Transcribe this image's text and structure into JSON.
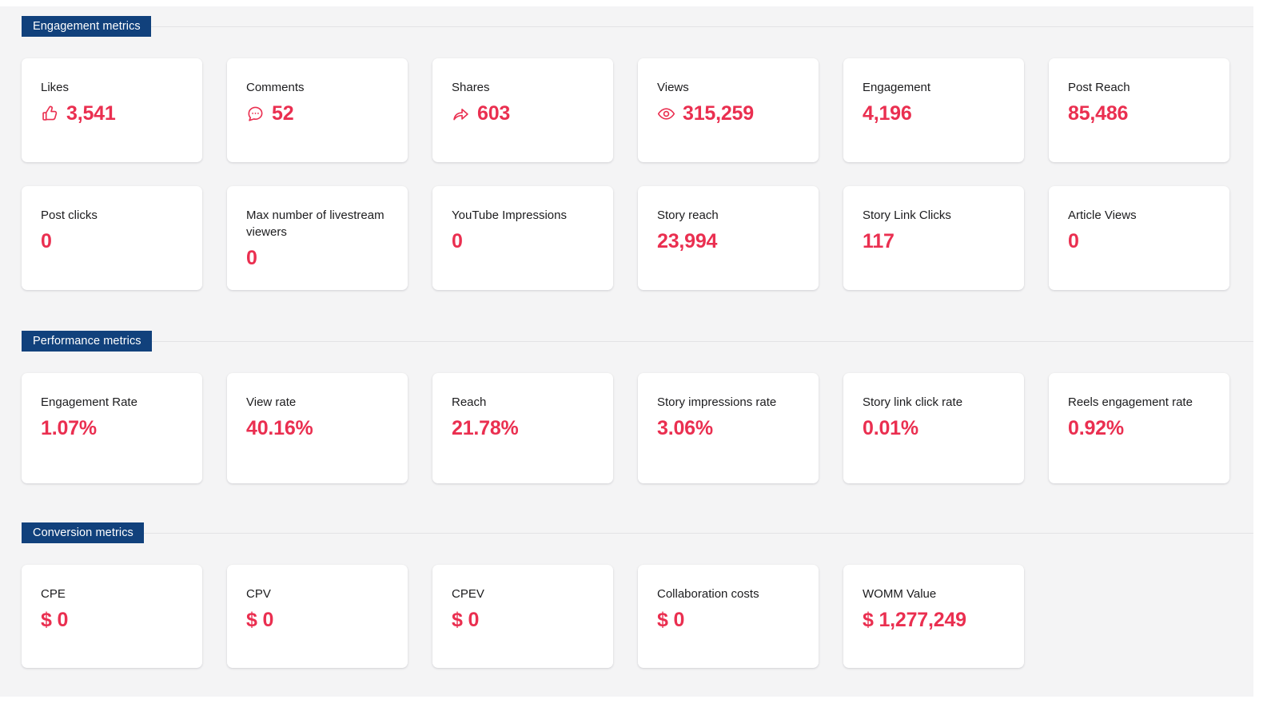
{
  "theme": {
    "accent_red": "#ea2f50",
    "badge_navy": "#11417c",
    "page_background": "#f4f4f5",
    "card_background": "#ffffff",
    "label_color": "#1c1c1e",
    "rule_color": "#e3e3e5"
  },
  "sections": [
    {
      "id": "engagement-metrics",
      "title": "Engagement metrics",
      "cards": [
        {
          "label": "Likes",
          "value": "3,541",
          "icon": "thumbs-up-icon"
        },
        {
          "label": "Comments",
          "value": "52",
          "icon": "comment-bubble-icon"
        },
        {
          "label": "Shares",
          "value": "603",
          "icon": "share-arrow-icon"
        },
        {
          "label": "Views",
          "value": "315,259",
          "icon": "eye-icon"
        },
        {
          "label": "Engagement",
          "value": "4,196",
          "icon": null
        },
        {
          "label": "Post Reach",
          "value": "85,486",
          "icon": null
        },
        {
          "label": "Post clicks",
          "value": "0",
          "icon": null
        },
        {
          "label": "Max number of livestream viewers",
          "value": "0",
          "icon": null
        },
        {
          "label": "YouTube Impressions",
          "value": "0",
          "icon": null
        },
        {
          "label": "Story reach",
          "value": "23,994",
          "icon": null
        },
        {
          "label": "Story Link Clicks",
          "value": "117",
          "icon": null
        },
        {
          "label": "Article Views",
          "value": "0",
          "icon": null
        }
      ]
    },
    {
      "id": "performance-metrics",
      "title": "Performance metrics",
      "cards": [
        {
          "label": "Engagement Rate",
          "value": "1.07%",
          "icon": null
        },
        {
          "label": "View rate",
          "value": "40.16%",
          "icon": null
        },
        {
          "label": "Reach",
          "value": "21.78%",
          "icon": null
        },
        {
          "label": "Story impressions rate",
          "value": "3.06%",
          "icon": null
        },
        {
          "label": "Story link click rate",
          "value": "0.01%",
          "icon": null
        },
        {
          "label": "Reels engagement rate",
          "value": "0.92%",
          "icon": null
        }
      ]
    },
    {
      "id": "conversion-metrics",
      "title": "Conversion metrics",
      "cards": [
        {
          "label": "CPE",
          "value": "$ 0",
          "icon": null
        },
        {
          "label": "CPV",
          "value": "$ 0",
          "icon": null
        },
        {
          "label": "CPEV",
          "value": "$ 0",
          "icon": null
        },
        {
          "label": "Collaboration costs",
          "value": "$ 0",
          "icon": null
        },
        {
          "label": "WOMM Value",
          "value": "$ 1,277,249",
          "icon": null
        }
      ]
    }
  ]
}
